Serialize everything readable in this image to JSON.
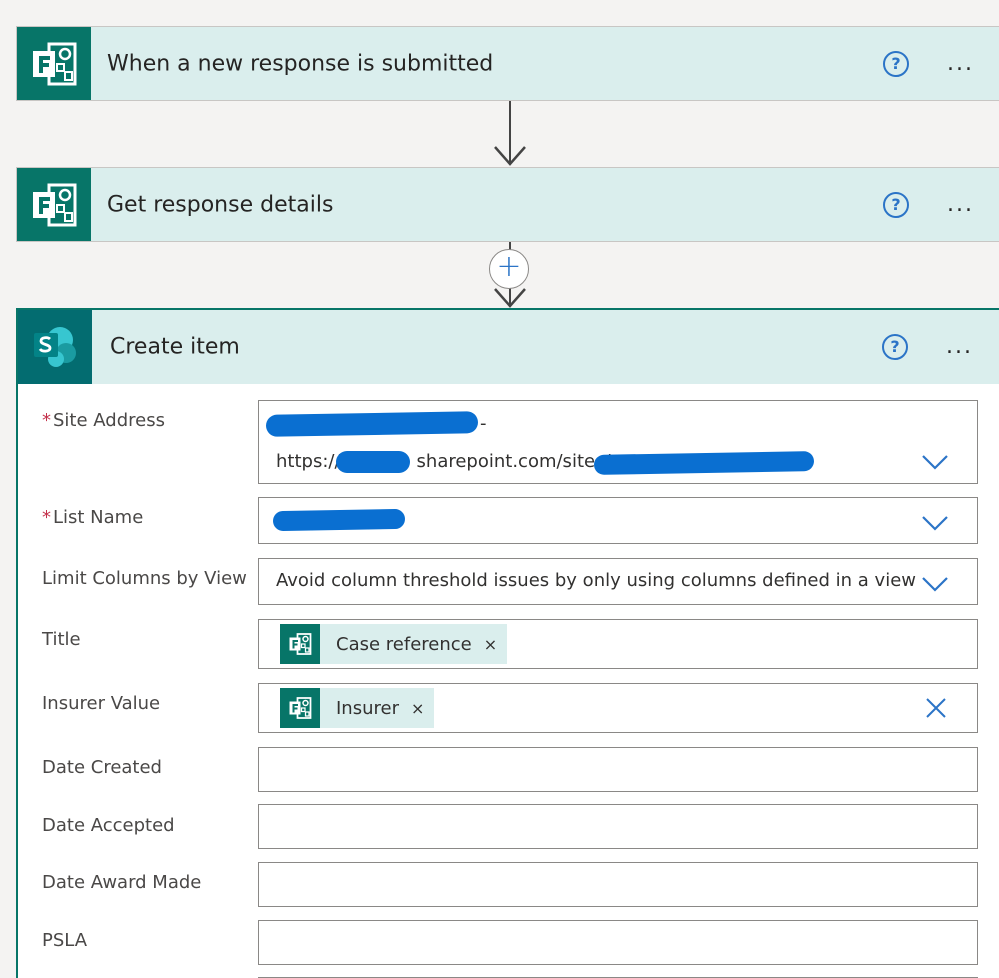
{
  "trigger": {
    "title": "When a new response is submitted",
    "help": "?",
    "more": "..."
  },
  "get_details": {
    "title": "Get response details",
    "help": "?",
    "more": "..."
  },
  "add_step": {
    "symbol": "+"
  },
  "create_item": {
    "title": "Create item",
    "help": "?",
    "more": "...",
    "required_mark": "*",
    "site_address": {
      "label": "Site Address",
      "line1_suffix": "-",
      "line2_prefix": "https://",
      "line2_middle": "sharepoint.com/sites/"
    },
    "list_name": {
      "label": "List Name"
    },
    "limit_columns": {
      "label": "Limit Columns by View",
      "value": "Avoid column threshold issues by only using columns defined in a view"
    },
    "title_field": {
      "label": "Title",
      "token": "Case reference",
      "token_remove": "×"
    },
    "insurer_field": {
      "label": "Insurer Value",
      "token": "Insurer",
      "token_remove": "×"
    },
    "date_created": {
      "label": "Date Created"
    },
    "date_accepted": {
      "label": "Date Accepted"
    },
    "date_award": {
      "label": "Date Award Made"
    },
    "psla": {
      "label": "PSLA"
    }
  },
  "colors": {
    "forms_green": "#077568",
    "card_header": "#daeeed",
    "link_blue": "#2b74c7",
    "redaction_blue": "#0a6fd1"
  },
  "icons": [
    "forms-icon",
    "sharepoint-icon",
    "help-icon",
    "more-icon",
    "chevron-down-icon",
    "clear-icon",
    "add-icon",
    "arrow-down-icon"
  ]
}
